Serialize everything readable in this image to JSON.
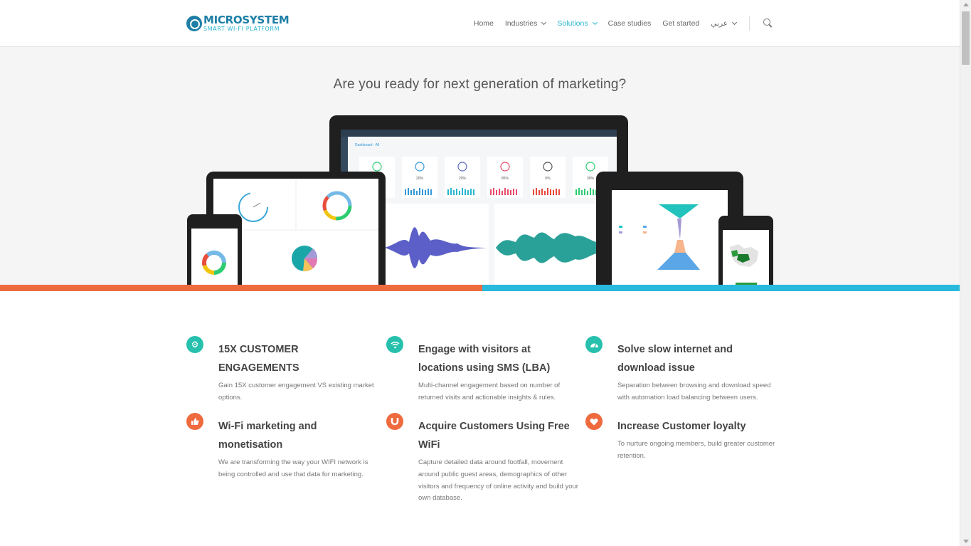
{
  "brand": {
    "name": "MICROSYSTEM",
    "tagline": "SMART WI-FI PLATFORM",
    "colors": {
      "primary": "#1d7fa6",
      "accent": "#29b5cf",
      "teal": "#26c0ad",
      "orange": "#ef6a3d"
    }
  },
  "nav": {
    "items": [
      {
        "label": "Home",
        "has_dropdown": false,
        "active": false
      },
      {
        "label": "Industries",
        "has_dropdown": true,
        "active": false
      },
      {
        "label": "Solutions",
        "has_dropdown": true,
        "active": true
      },
      {
        "label": "Case studies",
        "has_dropdown": false,
        "active": false
      },
      {
        "label": "Get started",
        "has_dropdown": false,
        "active": false
      },
      {
        "label": "عربي",
        "has_dropdown": true,
        "active": false
      }
    ],
    "search_icon": "search-icon"
  },
  "hero": {
    "title": "Are you ready for next generation of marketing?",
    "dashboard": {
      "breadcrumb": "Dashboard - All",
      "stats": [
        "20%",
        "20%",
        "85%",
        "0%",
        "30%"
      ]
    }
  },
  "features": [
    {
      "icon": "gears-icon",
      "color": "teal",
      "title": "15X CUSTOMER ENGAGEMENTS",
      "desc": "Gain 15X customer engagement VS existing market options."
    },
    {
      "icon": "wifi-icon",
      "color": "teal",
      "title": "Engage with visitors at locations using SMS (LBA)",
      "desc": "Multi-channel engagement based on number of returned visits and actionable insights & rules."
    },
    {
      "icon": "speedometer-icon",
      "color": "teal",
      "title": "Solve slow internet and download issue",
      "desc": "Separation between browsing and download speed with automation load balancing between users."
    },
    {
      "icon": "thumbs-up-icon",
      "color": "orange",
      "title": "Wi-Fi marketing and monetisation",
      "desc": "We are transforming the way your WIFI network is being controlled and use that data for marketing."
    },
    {
      "icon": "magnet-icon",
      "color": "orange",
      "title": "Acquire Customers Using Free WiFi",
      "desc": "Capture detailed data around footfall, movement around public guest areas, demographics of other visitors and frequency of online activity and build your own database."
    },
    {
      "icon": "heart-icon",
      "color": "orange",
      "title": "Increase Customer loyalty",
      "desc": "To nurture ongoing members, build greater customer retention."
    }
  ]
}
